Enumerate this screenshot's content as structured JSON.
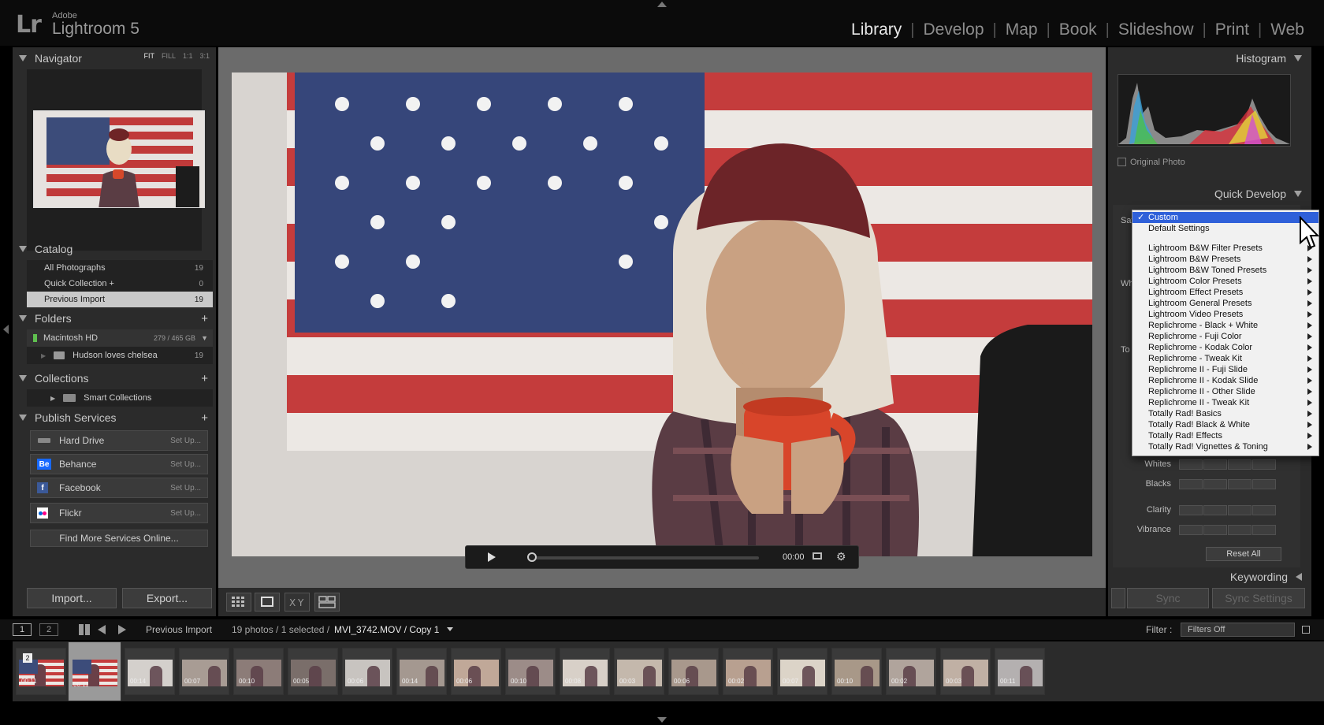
{
  "app": {
    "adobe": "Adobe",
    "product": "Lightroom 5",
    "logo": "Lr"
  },
  "modules": [
    "Library",
    "Develop",
    "Map",
    "Book",
    "Slideshow",
    "Print",
    "Web"
  ],
  "navigator": {
    "title": "Navigator",
    "zooms": [
      "FIT",
      "FILL",
      "1:1",
      "3:1"
    ]
  },
  "catalog": {
    "title": "Catalog",
    "items": [
      {
        "label": "All Photographs",
        "count": "19"
      },
      {
        "label": "Quick Collection +",
        "count": "0"
      },
      {
        "label": "Previous Import",
        "count": "19"
      }
    ]
  },
  "folders": {
    "title": "Folders",
    "drive": "Macintosh HD",
    "drive_space": "279 / 465 GB",
    "folder": "Hudson loves chelsea",
    "folder_count": "19"
  },
  "collections": {
    "title": "Collections",
    "smart": "Smart Collections"
  },
  "publish": {
    "title": "Publish Services",
    "services": [
      {
        "label": "Hard Drive",
        "setup": "Set Up..."
      },
      {
        "label": "Behance",
        "setup": "Set Up..."
      },
      {
        "label": "Facebook",
        "setup": "Set Up..."
      },
      {
        "label": "Flickr",
        "setup": "Set Up..."
      }
    ],
    "find_more": "Find More Services Online..."
  },
  "buttons": {
    "import": "Import...",
    "export": "Export...",
    "sync": "Sync",
    "sync_settings": "Sync Settings",
    "reset_all": "Reset All"
  },
  "video": {
    "time": "00:00"
  },
  "right": {
    "histogram": "Histogram",
    "original_photo": "Original Photo",
    "quick_develop": "Quick Develop",
    "keywording": "Keywording",
    "sliders": [
      "Whites",
      "Blacks",
      "Clarity",
      "Vibrance"
    ],
    "partial_labels": [
      "Sav",
      "Wh",
      "To"
    ]
  },
  "dropdown": {
    "items": [
      {
        "label": "Custom",
        "checked": true,
        "highlight": true
      },
      {
        "label": "Default Settings"
      },
      {
        "sep": true
      },
      {
        "label": "Lightroom B&W Filter Presets",
        "sub": true
      },
      {
        "label": "Lightroom B&W Presets",
        "sub": true
      },
      {
        "label": "Lightroom B&W Toned Presets",
        "sub": true
      },
      {
        "label": "Lightroom Color Presets",
        "sub": true
      },
      {
        "label": "Lightroom Effect Presets",
        "sub": true
      },
      {
        "label": "Lightroom General Presets",
        "sub": true
      },
      {
        "label": "Lightroom Video Presets",
        "sub": true
      },
      {
        "label": "Replichrome - Black + White",
        "sub": true
      },
      {
        "label": "Replichrome - Fuji Color",
        "sub": true
      },
      {
        "label": "Replichrome - Kodak Color",
        "sub": true
      },
      {
        "label": "Replichrome - Tweak Kit",
        "sub": true
      },
      {
        "label": "Replichrome II - Fuji Slide",
        "sub": true
      },
      {
        "label": "Replichrome II - Kodak Slide",
        "sub": true
      },
      {
        "label": "Replichrome II - Other Slide",
        "sub": true
      },
      {
        "label": "Replichrome II - Tweak Kit",
        "sub": true
      },
      {
        "label": "Totally Rad! Basics",
        "sub": true
      },
      {
        "label": "Totally Rad! Black & White",
        "sub": true
      },
      {
        "label": "Totally Rad! Effects",
        "sub": true
      },
      {
        "label": "Totally Rad! Vignettes & Toning",
        "sub": true
      }
    ]
  },
  "filmbar": {
    "screen1": "1",
    "screen2": "2",
    "source": "Previous Import",
    "info": "19 photos / 1 selected /",
    "file": "MVI_3742.MOV / Copy 1",
    "filter_label": "Filter :",
    "filter_value": "Filters Off"
  },
  "filmstrip": {
    "badge": "2",
    "durations": [
      "00:11",
      "00:11",
      "00:14",
      "00:07",
      "00:10",
      "00:05",
      "00:06",
      "00:14",
      "00:06",
      "00:10",
      "00:08",
      "00:03",
      "00:06",
      "00:02",
      "00:07",
      "00:10",
      "00:02",
      "00:03",
      "00:11"
    ]
  }
}
